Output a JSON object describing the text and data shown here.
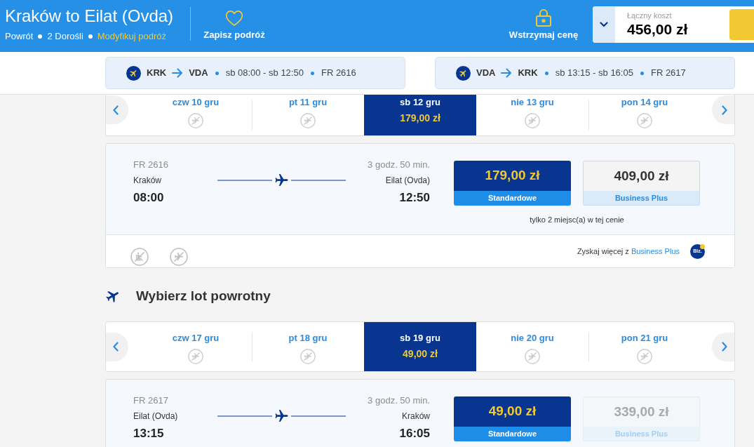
{
  "header": {
    "title": "Kraków to Eilat (Ovda)",
    "trip_details": [
      "Powrót",
      "2 Dorośli"
    ],
    "modify_link": "Modyfikuj podróż",
    "save_trip": "Zapisz podróż",
    "hold_price": "Wstrzymaj cenę",
    "total": {
      "label": "Łączny koszt",
      "amount": "456,00 zł"
    }
  },
  "flight_summaries": [
    {
      "origin": "KRK",
      "destination": "VDA",
      "times": "sb 08:00 - sb 12:50",
      "flight_number": "FR 2616"
    },
    {
      "origin": "VDA",
      "destination": "KRK",
      "times": "sb 13:15 - sb 16:05",
      "flight_number": "FR 2617"
    }
  ],
  "journeys": [
    {
      "dates": [
        {
          "label": "czw 10 gru",
          "selected": false,
          "available": false
        },
        {
          "label": "pt 11 gru",
          "selected": false,
          "available": false
        },
        {
          "label": "sb 12 gru",
          "selected": true,
          "available": true,
          "price": "179,00 zł"
        },
        {
          "label": "nie 13 gru",
          "selected": false,
          "available": false
        },
        {
          "label": "pon 14 gru",
          "selected": false,
          "available": false
        }
      ],
      "flight": {
        "flight_number": "FR 2616",
        "duration": "3 godz. 50 min.",
        "origin": "Kraków",
        "departure": "08:00",
        "destination": "Eilat (Ovda)",
        "arrival": "12:50",
        "fares": [
          {
            "kind": "standard",
            "price": "179,00 zł",
            "label": "Standardowe",
            "disabled": false
          },
          {
            "kind": "business",
            "price": "409,00 zł",
            "label": "Business Plus",
            "disabled": false
          }
        ],
        "seats_note": "tylko 2 miejsc(a) w tej cenie",
        "footer": {
          "text": "Zyskaj więcej z",
          "link": "Business Plus",
          "badge": "Biz."
        }
      }
    },
    {
      "heading": "Wybierz lot powrotny",
      "dates": [
        {
          "label": "czw 17 gru",
          "selected": false,
          "available": false
        },
        {
          "label": "pt 18 gru",
          "selected": false,
          "available": false
        },
        {
          "label": "sb 19 gru",
          "selected": true,
          "available": true,
          "price": "49,00 zł"
        },
        {
          "label": "nie 20 gru",
          "selected": false,
          "available": false
        },
        {
          "label": "pon 21 gru",
          "selected": false,
          "available": false
        }
      ],
      "flight": {
        "flight_number": "FR 2617",
        "duration": "3 godz. 50 min.",
        "origin": "Eilat (Ovda)",
        "departure": "13:15",
        "destination": "Kraków",
        "arrival": "16:05",
        "fares": [
          {
            "kind": "standard",
            "price": "49,00 zł",
            "label": "Standardowe",
            "disabled": false
          },
          {
            "kind": "business",
            "price": "339,00 zł",
            "label": "Business Plus",
            "disabled": true
          }
        ]
      }
    }
  ]
}
